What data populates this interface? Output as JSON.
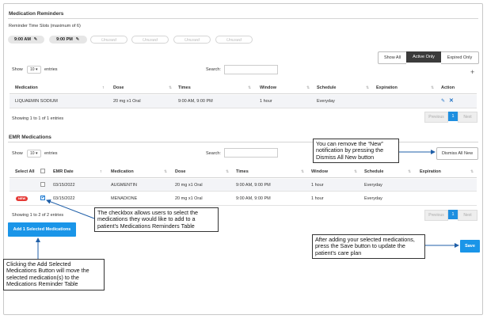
{
  "reminders": {
    "title": "Medication Reminders",
    "slots_label": "Reminder Time Slots (maximum of 6)",
    "slots": [
      {
        "label": "9:00 AM",
        "used": true
      },
      {
        "label": "9:00 PM",
        "used": true
      },
      {
        "label": "Unused",
        "used": false
      },
      {
        "label": "Unused",
        "used": false
      },
      {
        "label": "Unused",
        "used": false
      },
      {
        "label": "Unused",
        "used": false
      }
    ],
    "filters": {
      "all": "Show All",
      "active": "Active Only",
      "expired": "Expired Only"
    },
    "add_icon": "+",
    "show_label": "Show",
    "show_value": "10",
    "entries_label": "entries",
    "search_label": "Search:",
    "search_value": "",
    "columns": {
      "medication": "Medication",
      "dose": "Dose",
      "times": "Times",
      "window": "Window",
      "schedule": "Schedule",
      "expiration": "Expiration",
      "action": "Action"
    },
    "rows": [
      {
        "medication": "LIQUAEMIN SODIUM",
        "dose": "20 mg x1 Oral",
        "times": "9:00 AM, 9:00 PM",
        "window": "1 hour",
        "schedule": "Everyday",
        "expiration": ""
      }
    ],
    "showing": "Showing 1 to 1 of 1 entries",
    "pager": {
      "previous": "Previous",
      "current": "1",
      "next": "Next"
    }
  },
  "emr": {
    "title": "EMR Medications",
    "show_label": "Show",
    "show_value": "10",
    "entries_label": "entries",
    "search_label": "Search:",
    "search_value": "",
    "dismiss_label": "Dismiss All New",
    "columns": {
      "select_all": "Select All",
      "emr_date": "EMR Date",
      "medication": "Medication",
      "dose": "Dose",
      "times": "Times",
      "window": "Window",
      "schedule": "Schedule",
      "expiration": "Expiration"
    },
    "rows": [
      {
        "is_new": false,
        "checked": false,
        "emr_date": "03/15/2022",
        "medication": "AUGMENTIN",
        "dose": "20 mg x1 Oral",
        "times": "9:00 AM, 9:00 PM",
        "window": "1 hour",
        "schedule": "Everyday",
        "expiration": ""
      },
      {
        "is_new": true,
        "new_label": "NEW",
        "checked": true,
        "emr_date": "03/15/2022",
        "medication": "MENADIONE",
        "dose": "20 mg x1 Oral",
        "times": "9:00 AM, 9:00 PM",
        "window": "1 hour",
        "schedule": "Everyday",
        "expiration": ""
      }
    ],
    "showing": "Showing 1 to 2 of 2 entries",
    "pager": {
      "previous": "Previous",
      "current": "1",
      "next": "Next"
    },
    "add_button": "Add 1 Selected Medications",
    "save_button": "Save"
  },
  "callouts": {
    "dismiss": "You can remove the “New” notification by pressing the Dismiss All New button",
    "checkbox": "The checkbox allows users to select the medications they would like to add to a patient’s Medications Reminders Table",
    "add": "Clicking the Add Selected Medications Button will move the selected medication(s) to the Medications Reminder Table",
    "save": "After adding your selected medications, press the Save button to update the patient’s care plan"
  },
  "colors": {
    "accent": "#1a95e8",
    "new_badge": "#e53935",
    "active_filter": "#3b3b3b"
  }
}
